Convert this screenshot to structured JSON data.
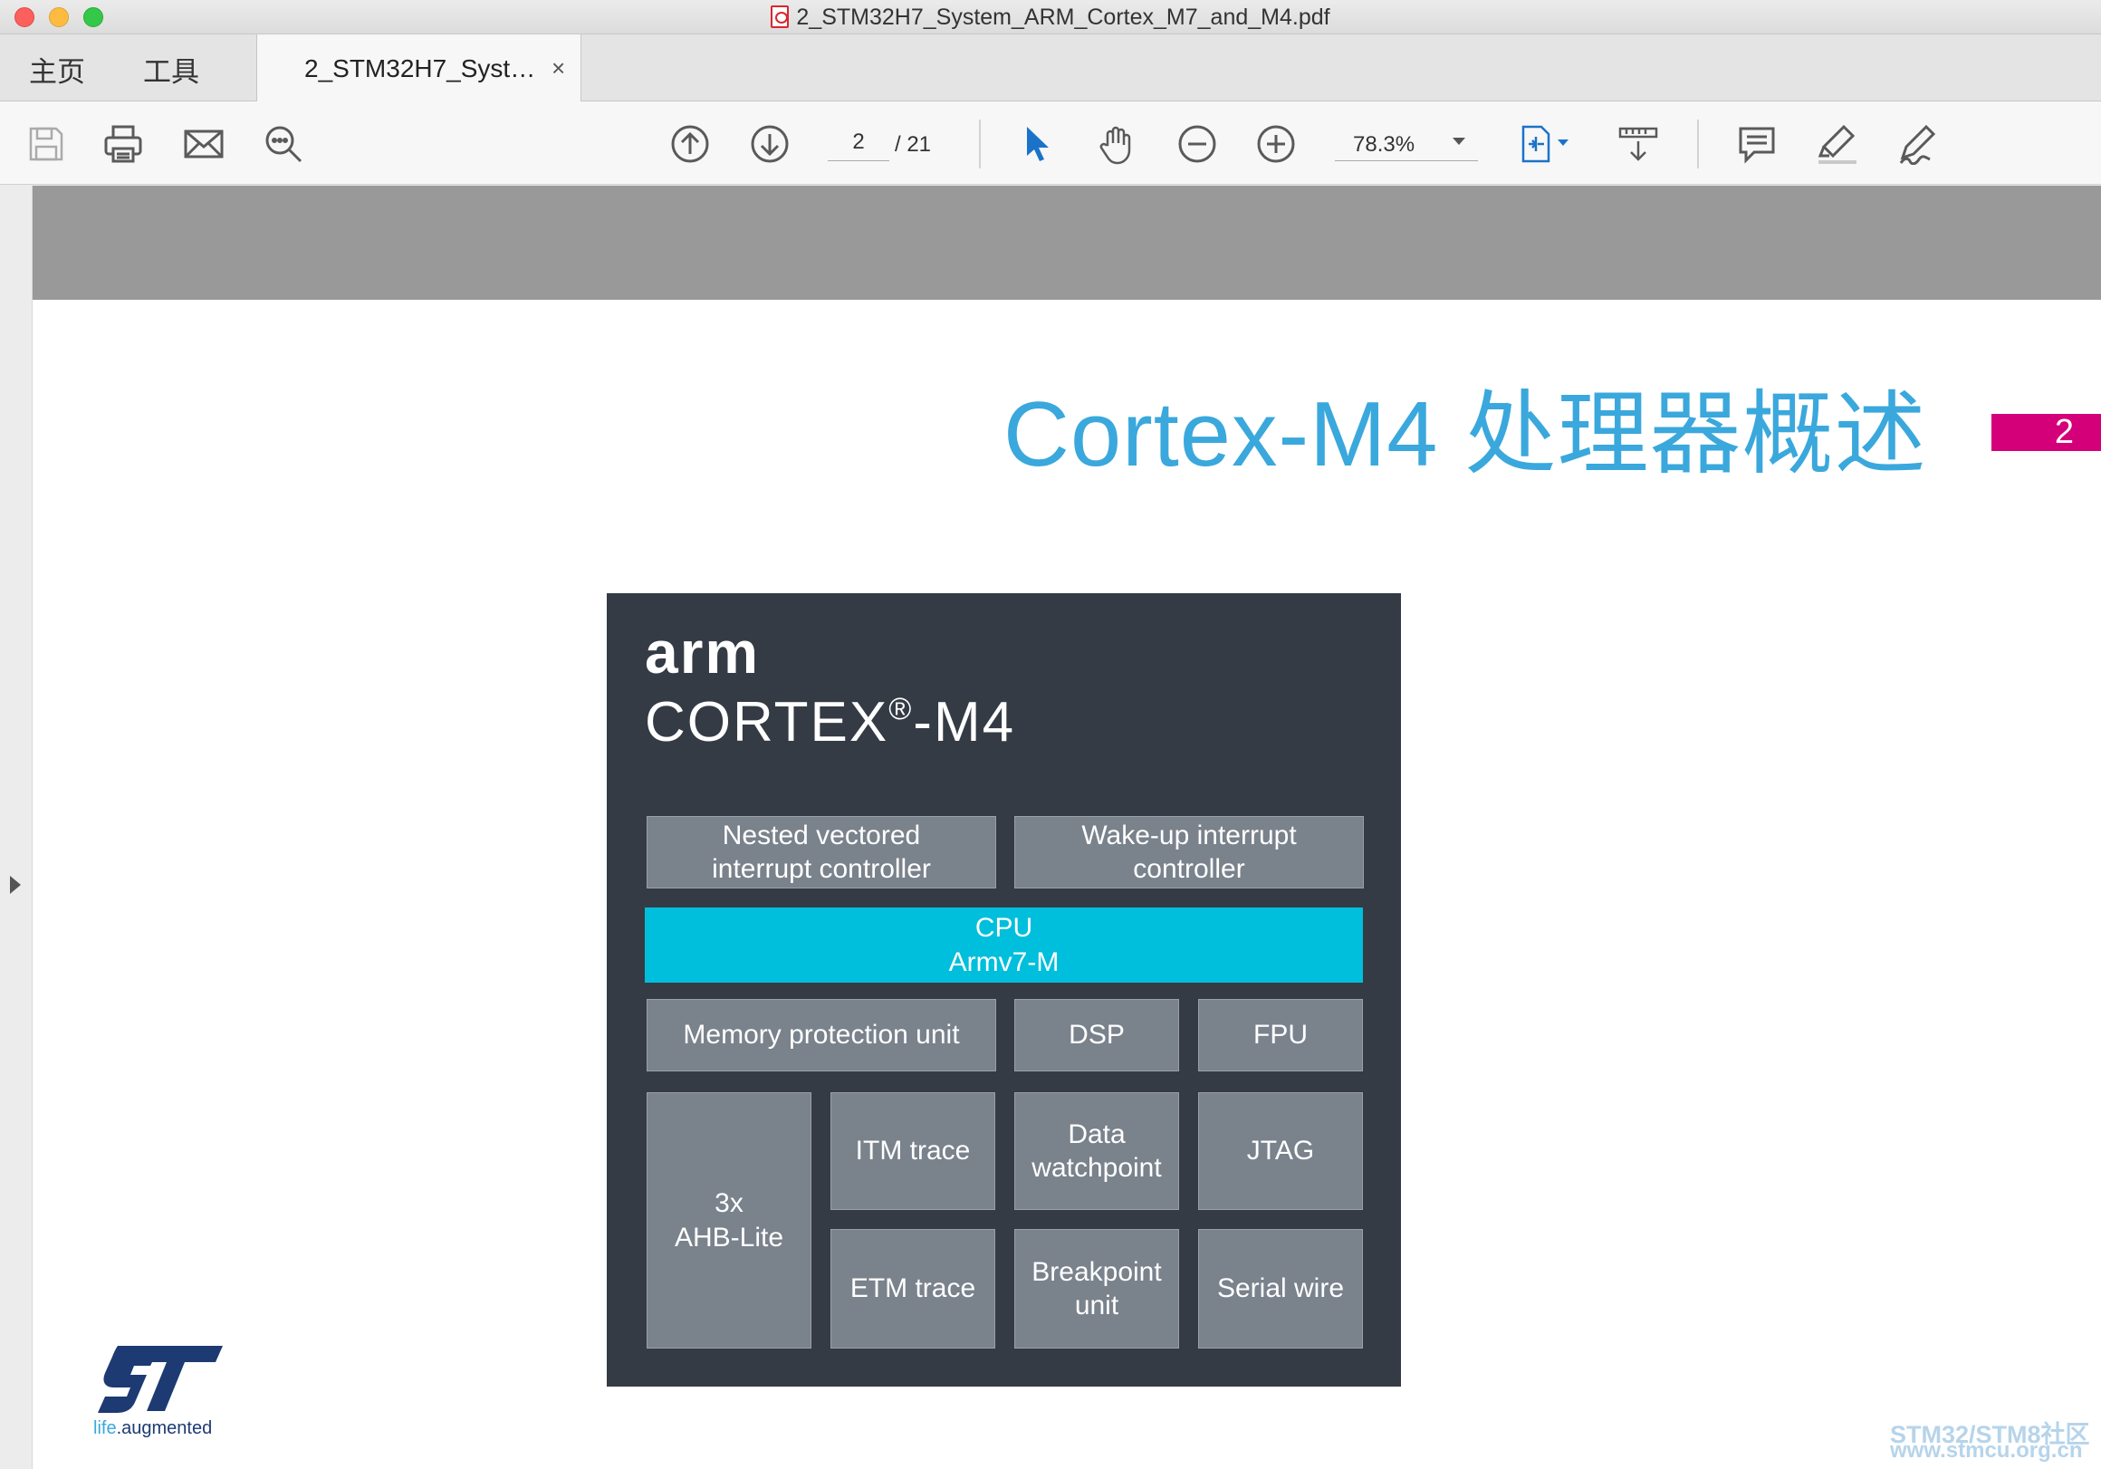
{
  "window": {
    "title": "2_STM32H7_System_ARM_Cortex_M7_and_M4.pdf"
  },
  "tabs": {
    "home": "主页",
    "tools": "工具",
    "document": "2_STM32H7_Syst…",
    "close": "×"
  },
  "toolbar": {
    "icons": [
      "save-icon",
      "print-icon",
      "email-icon",
      "search-icon",
      "page-up-icon",
      "page-down-icon",
      "select-pointer-icon",
      "hand-pan-icon",
      "zoom-out-icon",
      "zoom-in-icon",
      "fit-page-icon",
      "scroll-mode-icon",
      "comment-icon",
      "highlight-icon",
      "sign-icon"
    ],
    "page_current": "2",
    "page_total": "/ 21",
    "zoom": "78.3%"
  },
  "slide": {
    "title": "Cortex-M4 处理器概述",
    "page_number": "2",
    "arm_logo": "arm",
    "cortex_label": "CORTEX",
    "cortex_reg": "®",
    "cortex_suffix": "-M4",
    "blocks": {
      "nvic": "Nested vectored\ninterrupt controller",
      "wic": "Wake-up interrupt\ncontroller",
      "cpu": "CPU\nArmv7-M",
      "mpu": "Memory protection unit",
      "dsp": "DSP",
      "fpu": "FPU",
      "ahb": "3x\nAHB-Lite",
      "itm": "ITM trace",
      "dwt": "Data\nwatchpoint",
      "jtag": "JTAG",
      "etm": "ETM trace",
      "bpu": "Breakpoint\nunit",
      "swd": "Serial wire"
    },
    "st_tagline_life": "life",
    "st_tagline_rest": ".augmented"
  },
  "watermark": {
    "line1": "STM32/STM8社区",
    "line2": "www.stmcu.org.cn"
  },
  "colors": {
    "title_blue": "#3aa8dc",
    "badge_magenta": "#d4007a",
    "arm_dark": "#343b45",
    "block_gray": "#7a828c",
    "cpu_cyan": "#00bfdc",
    "st_blue": "#1d3a72"
  }
}
